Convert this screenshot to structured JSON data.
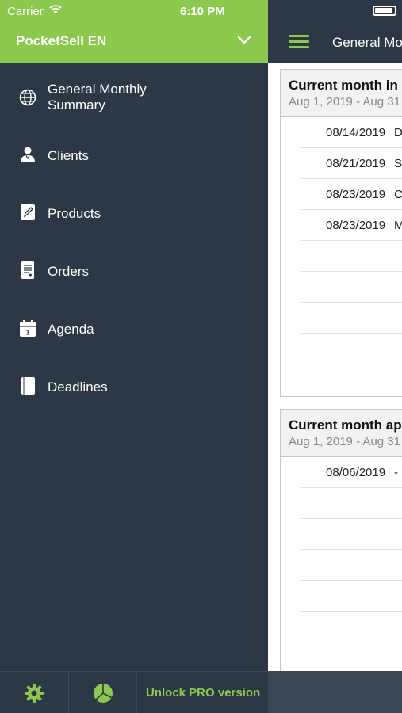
{
  "status": {
    "carrier": "Carrier",
    "time": "6:10 PM"
  },
  "sidebar": {
    "title": "PocketSell EN",
    "items": [
      {
        "label_line1": "General Monthly",
        "label_line2": "Summary",
        "icon": "globe-icon"
      },
      {
        "label_line1": "Clients",
        "label_line2": "",
        "icon": "person-icon"
      },
      {
        "label_line1": "Products",
        "label_line2": "",
        "icon": "edit-icon"
      },
      {
        "label_line1": "Orders",
        "label_line2": "",
        "icon": "receipt-icon"
      },
      {
        "label_line1": "Agenda",
        "label_line2": "",
        "icon": "calendar-icon"
      },
      {
        "label_line1": "Deadlines",
        "label_line2": "",
        "icon": "book-icon"
      }
    ],
    "footer": {
      "unlock_label": "Unlock PRO version"
    }
  },
  "main": {
    "nav_title": "General Mo",
    "cards": [
      {
        "title": "Current month in",
        "subtitle": "Aug 1, 2019 - Aug 31",
        "rows": [
          {
            "date": "08/14/2019",
            "desc": "D"
          },
          {
            "date": "08/21/2019",
            "desc": "S"
          },
          {
            "date": "08/23/2019",
            "desc": "C"
          },
          {
            "date": "08/23/2019",
            "desc": "M"
          }
        ]
      },
      {
        "title": "Current month ap",
        "subtitle": "Aug 1, 2019 - Aug 31",
        "rows": [
          {
            "date": "08/06/2019",
            "desc": "-"
          }
        ]
      }
    ]
  },
  "colors": {
    "accent": "#8cc84b",
    "sidebar_bg": "#2c3846"
  }
}
